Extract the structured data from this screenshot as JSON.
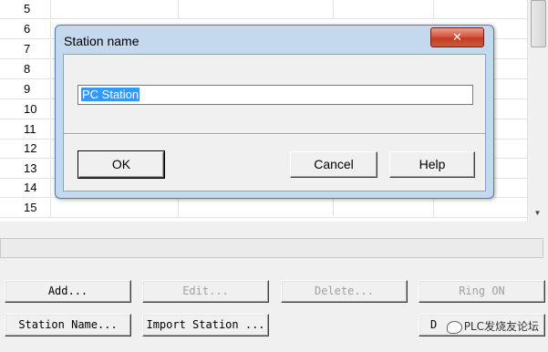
{
  "grid": {
    "row_numbers": [
      "5",
      "6",
      "7",
      "8",
      "9",
      "10",
      "11",
      "12",
      "13",
      "14",
      "15"
    ]
  },
  "dialog": {
    "title": "Station name",
    "close_label": "✕",
    "name_value": "PC Station",
    "ok_label": "OK",
    "cancel_label": "Cancel",
    "help_label": "Help"
  },
  "buttons": {
    "add": "Add...",
    "edit": "Edit...",
    "delete": "Delete...",
    "ring_on": "Ring ON",
    "station_name": "Station Name...",
    "import_station": "Import Station ...",
    "partial_label": "D"
  },
  "watermark": {
    "text": "PLC发烧友论坛"
  },
  "icons": {
    "scroll_down": "scroll-down-arrow-icon",
    "close": "close-icon"
  },
  "colors": {
    "selection": "#3399ff",
    "close_button": "#c23a22",
    "dialog_frame": "#c4d8ee"
  }
}
